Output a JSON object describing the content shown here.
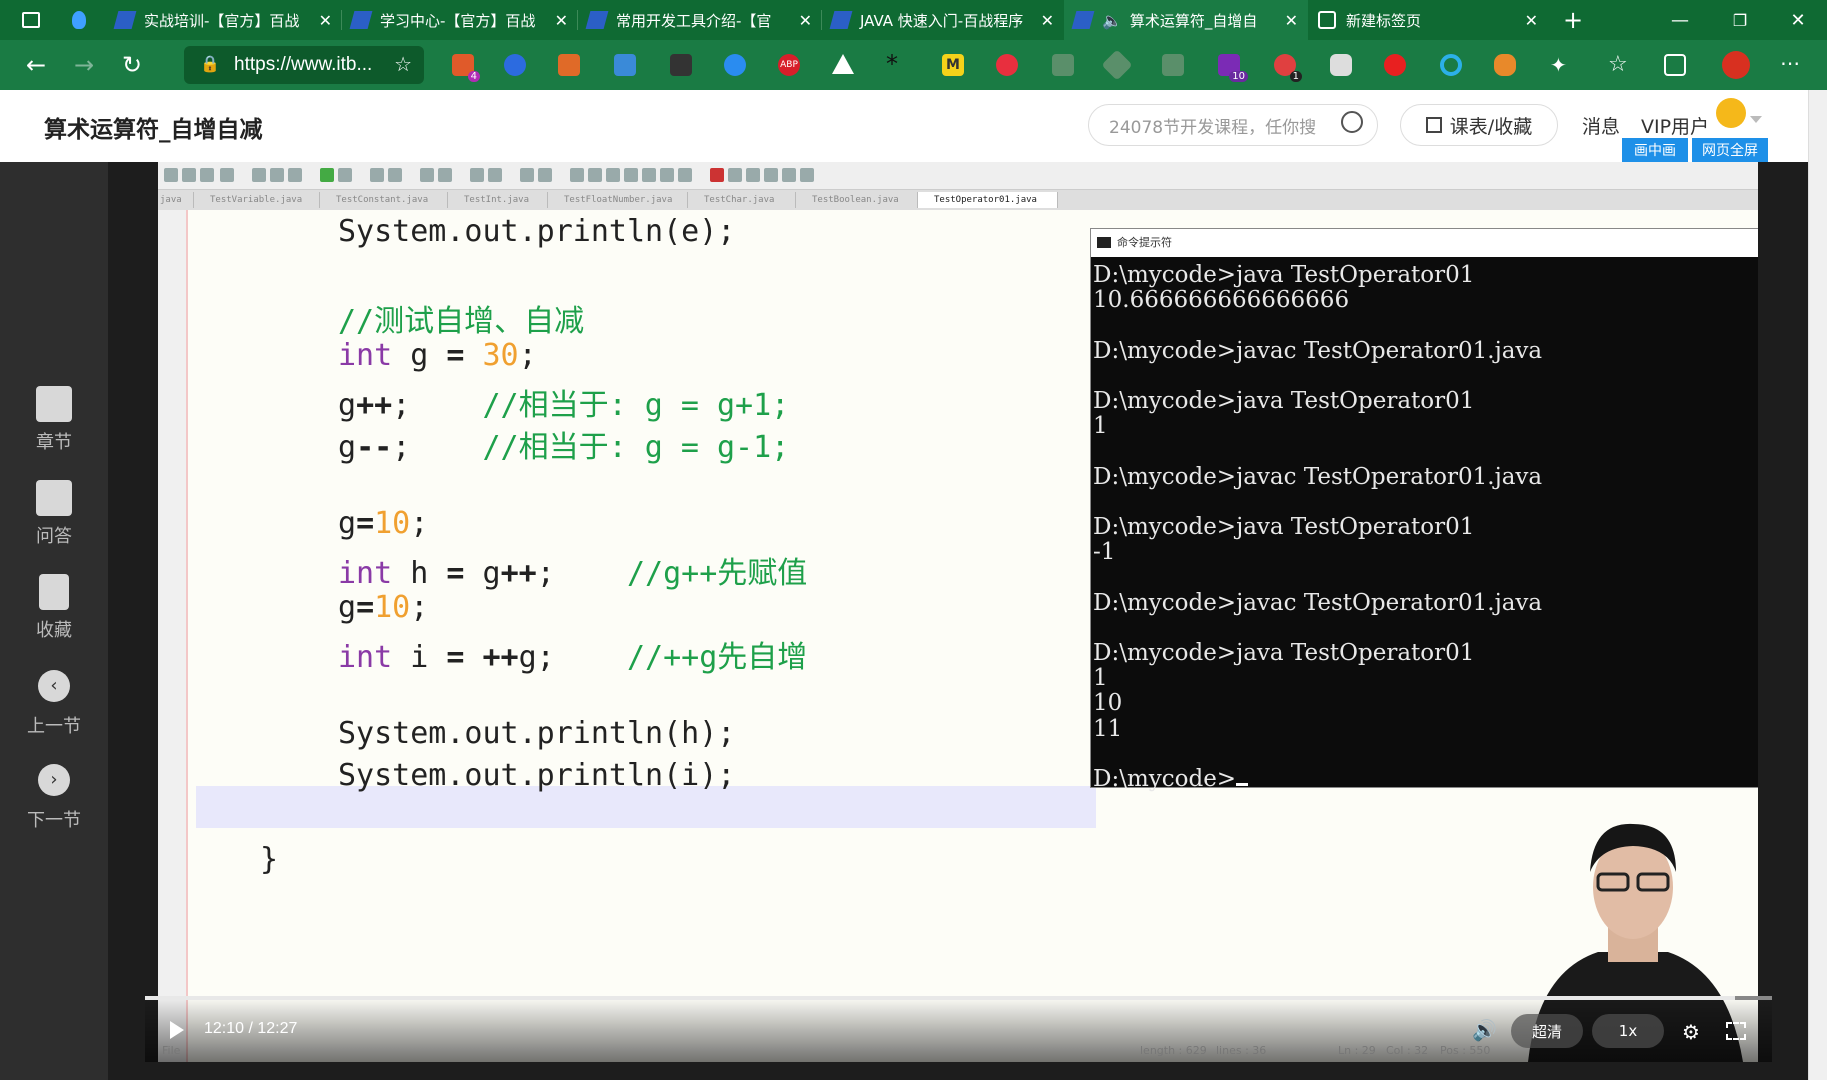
{
  "browser": {
    "tabs": [
      {
        "label": "",
        "icon": "shield-icon"
      },
      {
        "label": "实战培训-【官方】百战",
        "icon": "page-icon"
      },
      {
        "label": "学习中心-【官方】百战",
        "icon": "page-icon"
      },
      {
        "label": "常用开发工具介绍-【官",
        "icon": "page-icon"
      },
      {
        "label": "JAVA 快速入门-百战程序",
        "icon": "page-icon"
      },
      {
        "label": "算术运算符_自增自",
        "icon": "speaker-icon",
        "active": true
      },
      {
        "label": "新建标签页",
        "icon": "newtab-icon"
      }
    ],
    "url": "https://www.itb...",
    "ext_badges": [
      "4",
      "10",
      "1"
    ],
    "ext_abp": "ABP",
    "ext_m": "M"
  },
  "header": {
    "title": "算术运算符_自增自减",
    "search_placeholder": "24078节开发课程，任你搜",
    "schedule_label": "课表/收藏",
    "messages_label": "消息",
    "vip_label": "VIP用户",
    "pip_label": "画中画",
    "fullpage_label": "网页全屏"
  },
  "sidebar": {
    "items": [
      {
        "label": "章节",
        "icon": "chapter-icon"
      },
      {
        "label": "问答",
        "icon": "qa-icon"
      },
      {
        "label": "收藏",
        "icon": "bookmark-icon"
      },
      {
        "label": "上一节",
        "icon": "prev-icon"
      },
      {
        "label": "下一节",
        "icon": "next-icon"
      }
    ]
  },
  "editor": {
    "file_tabs": [
      "java",
      "TestVariable.java",
      "TestConstant.java",
      "TestInt.java",
      "TestFloatNumber.java",
      "TestChar.java",
      "TestBoolean.java",
      "TestOperator01.java"
    ],
    "lines": [
      "System.out.println(e);",
      "",
      "//测试自增、自减",
      "int g = 30;",
      "g++;    //相当于: g = g+1;",
      "g--;    //相当于: g = g-1;",
      "",
      "g=10;",
      "int h = g++;    //g++先赋值",
      "g=10;",
      "int i = ++g;    //++g先自增",
      "",
      "System.out.println(h);",
      "System.out.println(i);",
      "",
      "}"
    ],
    "status_length": "length : 629",
    "status_lines": "lines : 36",
    "status_ln": "Ln : 29",
    "status_col": "Col : 32",
    "status_pos": "Pos : 550",
    "status_file": "File"
  },
  "cmd": {
    "title": "命令提示符",
    "output": "D:\\mycode>java TestOperator01\n10.666666666666666\n\nD:\\mycode>javac TestOperator01.java\n\nD:\\mycode>java TestOperator01\n1\n\nD:\\mycode>javac TestOperator01.java\n\nD:\\mycode>java TestOperator01\n-1\n\nD:\\mycode>javac TestOperator01.java\n\nD:\\mycode>java TestOperator01\n1\n10\n11\n\nD:\\mycode>"
  },
  "player": {
    "time": "12:10 / 12:27",
    "progress": 0.977,
    "quality_label": "超清",
    "speed_label": "1x"
  }
}
